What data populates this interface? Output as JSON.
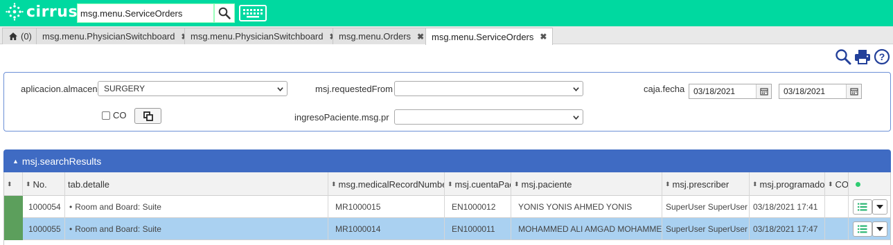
{
  "app": {
    "brand": "cirrus",
    "search_value": "msg.menu.ServiceOrders"
  },
  "tabs": [
    {
      "label": "(0)"
    },
    {
      "label": "msg.menu.PhysicianSwitchboard"
    },
    {
      "label": "msg.menu.PhysicianSwitchboard"
    },
    {
      "label": "msg.menu.Orders"
    },
    {
      "label": "msg.menu.ServiceOrders"
    }
  ],
  "filters": {
    "almacen_label": "aplicacion.almacen",
    "almacen_value": "SURGERY",
    "co_label": "CO",
    "requested_from_label": "msj.requestedFrom",
    "requested_from_value": "",
    "ingreso_label": "ingresoPaciente.msg.pr",
    "ingreso_value": "",
    "fecha_label": "caja.fecha",
    "date_from": "03/18/2021",
    "date_to": "03/18/2021"
  },
  "results": {
    "title": "msj.searchResults",
    "columns": [
      "No.",
      "tab.detalle",
      "msg.medicalRecordNumber",
      "msj.cuentaPac",
      "msj.paciente",
      "msj.prescriber",
      "msj.programado",
      "CO"
    ],
    "rows": [
      {
        "no": "1000054",
        "detalle": "Room and Board: Suite",
        "mrn": "MR1000015",
        "cuenta": "EN1000012",
        "paciente": "YONIS YONIS AHMED YONIS",
        "prescriber": "SuperUser SuperUser",
        "programado": "03/18/2021 17:41"
      },
      {
        "no": "1000055",
        "detalle": "Room and Board: Suite",
        "mrn": "MR1000014",
        "cuenta": "EN1000011",
        "paciente": "MOHAMMED ALI AMGAD MOHAMMED",
        "prescriber": "SuperUser SuperUser",
        "programado": "03/18/2021 17:47"
      }
    ]
  },
  "colors": {
    "topbar": "#00d9a0",
    "accent": "#3f6bc3",
    "selected_row": "#aad1f1",
    "row_marker": "#5c9f5c"
  }
}
